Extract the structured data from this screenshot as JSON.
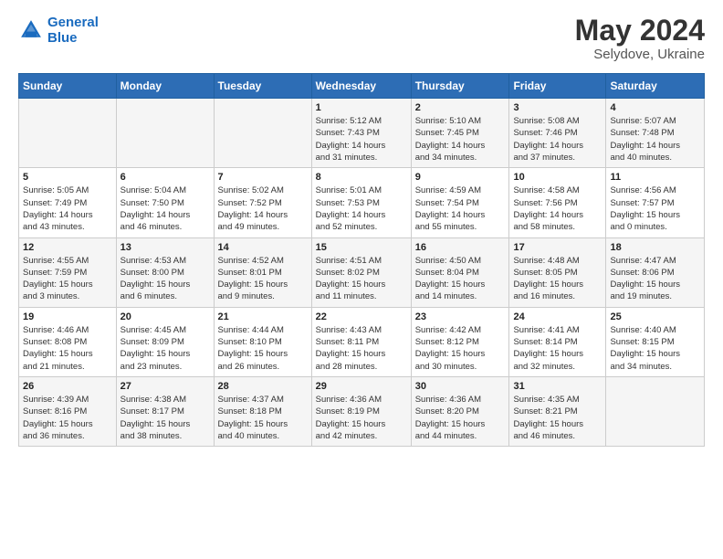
{
  "logo": {
    "line1": "General",
    "line2": "Blue"
  },
  "title": "May 2024",
  "subtitle": "Selydove, Ukraine",
  "days_of_week": [
    "Sunday",
    "Monday",
    "Tuesday",
    "Wednesday",
    "Thursday",
    "Friday",
    "Saturday"
  ],
  "weeks": [
    [
      {
        "day": "",
        "info": ""
      },
      {
        "day": "",
        "info": ""
      },
      {
        "day": "",
        "info": ""
      },
      {
        "day": "1",
        "info": "Sunrise: 5:12 AM\nSunset: 7:43 PM\nDaylight: 14 hours\nand 31 minutes."
      },
      {
        "day": "2",
        "info": "Sunrise: 5:10 AM\nSunset: 7:45 PM\nDaylight: 14 hours\nand 34 minutes."
      },
      {
        "day": "3",
        "info": "Sunrise: 5:08 AM\nSunset: 7:46 PM\nDaylight: 14 hours\nand 37 minutes."
      },
      {
        "day": "4",
        "info": "Sunrise: 5:07 AM\nSunset: 7:48 PM\nDaylight: 14 hours\nand 40 minutes."
      }
    ],
    [
      {
        "day": "5",
        "info": "Sunrise: 5:05 AM\nSunset: 7:49 PM\nDaylight: 14 hours\nand 43 minutes."
      },
      {
        "day": "6",
        "info": "Sunrise: 5:04 AM\nSunset: 7:50 PM\nDaylight: 14 hours\nand 46 minutes."
      },
      {
        "day": "7",
        "info": "Sunrise: 5:02 AM\nSunset: 7:52 PM\nDaylight: 14 hours\nand 49 minutes."
      },
      {
        "day": "8",
        "info": "Sunrise: 5:01 AM\nSunset: 7:53 PM\nDaylight: 14 hours\nand 52 minutes."
      },
      {
        "day": "9",
        "info": "Sunrise: 4:59 AM\nSunset: 7:54 PM\nDaylight: 14 hours\nand 55 minutes."
      },
      {
        "day": "10",
        "info": "Sunrise: 4:58 AM\nSunset: 7:56 PM\nDaylight: 14 hours\nand 58 minutes."
      },
      {
        "day": "11",
        "info": "Sunrise: 4:56 AM\nSunset: 7:57 PM\nDaylight: 15 hours\nand 0 minutes."
      }
    ],
    [
      {
        "day": "12",
        "info": "Sunrise: 4:55 AM\nSunset: 7:59 PM\nDaylight: 15 hours\nand 3 minutes."
      },
      {
        "day": "13",
        "info": "Sunrise: 4:53 AM\nSunset: 8:00 PM\nDaylight: 15 hours\nand 6 minutes."
      },
      {
        "day": "14",
        "info": "Sunrise: 4:52 AM\nSunset: 8:01 PM\nDaylight: 15 hours\nand 9 minutes."
      },
      {
        "day": "15",
        "info": "Sunrise: 4:51 AM\nSunset: 8:02 PM\nDaylight: 15 hours\nand 11 minutes."
      },
      {
        "day": "16",
        "info": "Sunrise: 4:50 AM\nSunset: 8:04 PM\nDaylight: 15 hours\nand 14 minutes."
      },
      {
        "day": "17",
        "info": "Sunrise: 4:48 AM\nSunset: 8:05 PM\nDaylight: 15 hours\nand 16 minutes."
      },
      {
        "day": "18",
        "info": "Sunrise: 4:47 AM\nSunset: 8:06 PM\nDaylight: 15 hours\nand 19 minutes."
      }
    ],
    [
      {
        "day": "19",
        "info": "Sunrise: 4:46 AM\nSunset: 8:08 PM\nDaylight: 15 hours\nand 21 minutes."
      },
      {
        "day": "20",
        "info": "Sunrise: 4:45 AM\nSunset: 8:09 PM\nDaylight: 15 hours\nand 23 minutes."
      },
      {
        "day": "21",
        "info": "Sunrise: 4:44 AM\nSunset: 8:10 PM\nDaylight: 15 hours\nand 26 minutes."
      },
      {
        "day": "22",
        "info": "Sunrise: 4:43 AM\nSunset: 8:11 PM\nDaylight: 15 hours\nand 28 minutes."
      },
      {
        "day": "23",
        "info": "Sunrise: 4:42 AM\nSunset: 8:12 PM\nDaylight: 15 hours\nand 30 minutes."
      },
      {
        "day": "24",
        "info": "Sunrise: 4:41 AM\nSunset: 8:14 PM\nDaylight: 15 hours\nand 32 minutes."
      },
      {
        "day": "25",
        "info": "Sunrise: 4:40 AM\nSunset: 8:15 PM\nDaylight: 15 hours\nand 34 minutes."
      }
    ],
    [
      {
        "day": "26",
        "info": "Sunrise: 4:39 AM\nSunset: 8:16 PM\nDaylight: 15 hours\nand 36 minutes."
      },
      {
        "day": "27",
        "info": "Sunrise: 4:38 AM\nSunset: 8:17 PM\nDaylight: 15 hours\nand 38 minutes."
      },
      {
        "day": "28",
        "info": "Sunrise: 4:37 AM\nSunset: 8:18 PM\nDaylight: 15 hours\nand 40 minutes."
      },
      {
        "day": "29",
        "info": "Sunrise: 4:36 AM\nSunset: 8:19 PM\nDaylight: 15 hours\nand 42 minutes."
      },
      {
        "day": "30",
        "info": "Sunrise: 4:36 AM\nSunset: 8:20 PM\nDaylight: 15 hours\nand 44 minutes."
      },
      {
        "day": "31",
        "info": "Sunrise: 4:35 AM\nSunset: 8:21 PM\nDaylight: 15 hours\nand 46 minutes."
      },
      {
        "day": "",
        "info": ""
      }
    ]
  ]
}
